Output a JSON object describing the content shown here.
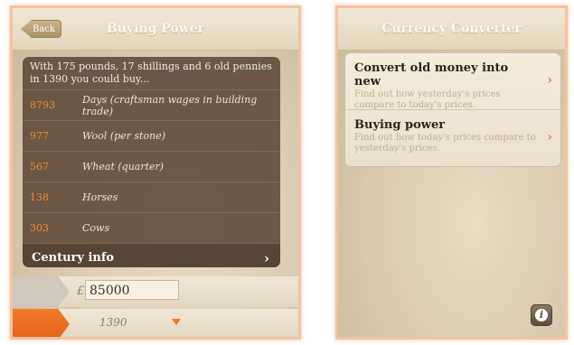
{
  "left_screen": {
    "title": "Buying Power",
    "back_label": "Back",
    "intro": "With 175 pounds, 17 shillings and 6 old pennies in 1390 you could buy...",
    "rows": [
      {
        "value": "8793",
        "label": "Days (craftsman wages in building trade)"
      },
      {
        "value": "977",
        "label": "Wool (per stone)"
      },
      {
        "value": "567",
        "label": "Wheat (quarter)"
      },
      {
        "value": "138",
        "label": "Horses"
      },
      {
        "value": "303",
        "label": "Cows"
      }
    ],
    "century_label": "Century info",
    "chevron": "›",
    "currency_symbol": "£",
    "amount": "85000",
    "year": "1390"
  },
  "right_screen": {
    "title": "Currency Converter",
    "items": [
      {
        "title": "Convert old money into new",
        "subtitle": "Find out how yesterday's prices compare to today's prices.",
        "chevron": "›"
      },
      {
        "title": "Buying power",
        "subtitle": "Find out how today's prices compare to yesterday's prices.",
        "chevron": "›"
      }
    ],
    "info_label": "i"
  },
  "colors": {
    "accent": "#f07a2a",
    "panel": "#5c4837"
  }
}
